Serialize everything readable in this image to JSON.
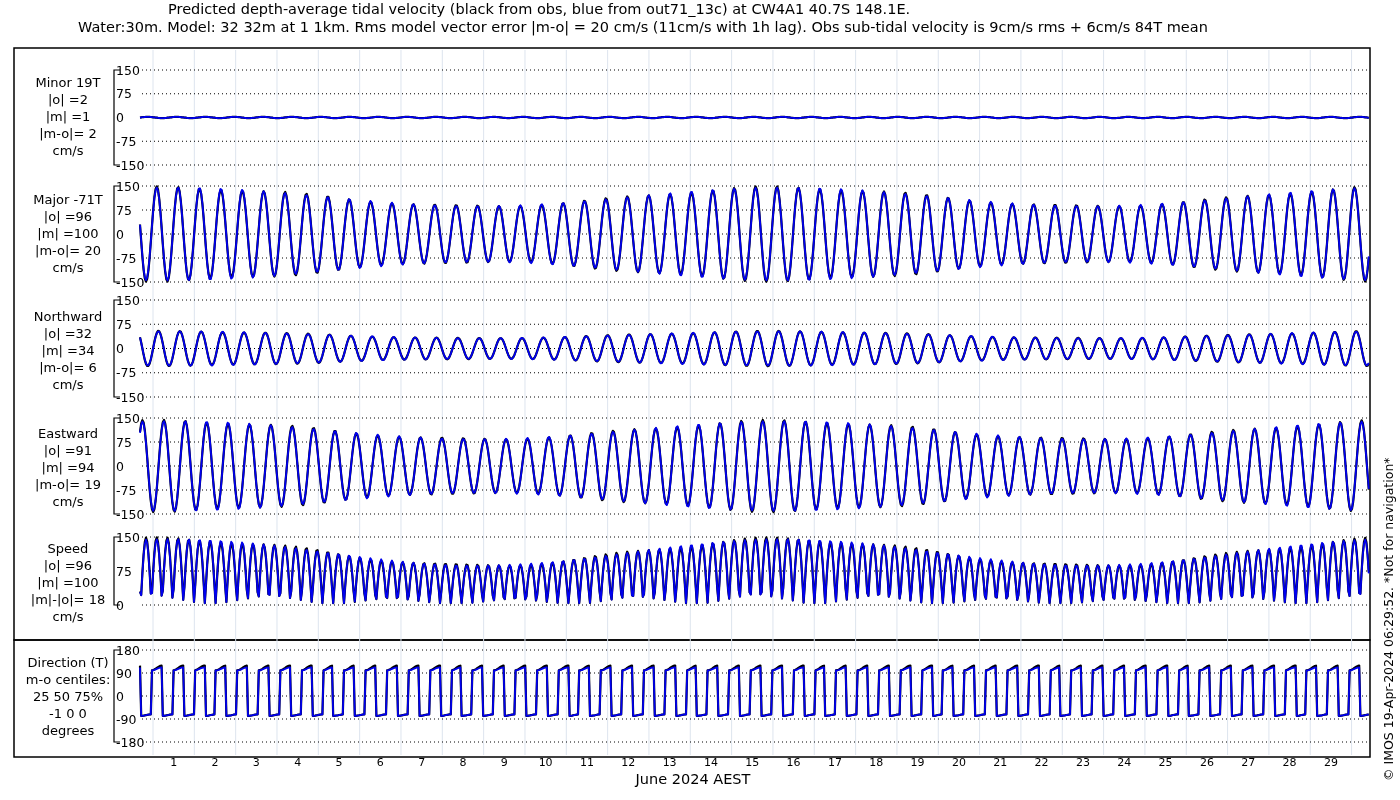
{
  "title_lines": [
    "Predicted depth-average tidal velocity (black from obs, blue from out71_13c) at CW4A1 40.7S 148.1E.",
    "Water:30m. Model: 32 32m at 1 1km. Rms model vector error |m-o| = 20 cm/s (11cm/s with 1h lag). Obs sub-tidal velocity is 9cm/s rms + 6cm/s 84T mean"
  ],
  "panels": [
    {
      "kind": "wave",
      "label_lines": [
        "Minor 19T",
        "|o| =2",
        "|m| =1",
        "|m-o|= 2",
        "cm/s"
      ],
      "yticks": [
        "150",
        "75",
        "0",
        "-75",
        "-150"
      ]
    },
    {
      "kind": "wave",
      "label_lines": [
        "Major -71T",
        "|o| =96",
        "|m| =100",
        "|m-o|= 20",
        "cm/s"
      ],
      "yticks": [
        "150",
        "75",
        "0",
        "-75",
        "-150"
      ]
    },
    {
      "kind": "wave",
      "label_lines": [
        "Northward",
        "|o| =32",
        "|m| =34",
        "|m-o|= 6",
        "cm/s"
      ],
      "yticks": [
        "150",
        "75",
        "0",
        "-75",
        "-150"
      ]
    },
    {
      "kind": "wave",
      "label_lines": [
        "Eastward",
        "|o| =91",
        "|m| =94",
        "|m-o|= 19",
        "cm/s"
      ],
      "yticks": [
        "150",
        "75",
        "0",
        "-75",
        "-150"
      ]
    },
    {
      "kind": "speed",
      "label_lines": [
        "Speed",
        "|o| =96",
        "|m| =100",
        "|m|-|o|= 18",
        "cm/s"
      ],
      "yticks": [
        "150",
        "75",
        "0"
      ]
    },
    {
      "kind": "direction",
      "label_lines": [
        "Direction (T)",
        "m-o centiles:",
        "25  50  75%",
        "-1  0  0",
        "degrees"
      ],
      "yticks": [
        "180",
        "90",
        "0",
        "-90",
        "-180"
      ]
    }
  ],
  "xticks": [
    "1",
    "2",
    "3",
    "4",
    "5",
    "6",
    "7",
    "8",
    "9",
    "10",
    "11",
    "12",
    "13",
    "14",
    "15",
    "16",
    "17",
    "18",
    "19",
    "20",
    "21",
    "22",
    "23",
    "24",
    "25",
    "26",
    "27",
    "28",
    "29"
  ],
  "xlabel": "June 2024 AEST",
  "footer": "© IMOS 19-Apr-2024 06:29:52. *Not for navigation*"
}
